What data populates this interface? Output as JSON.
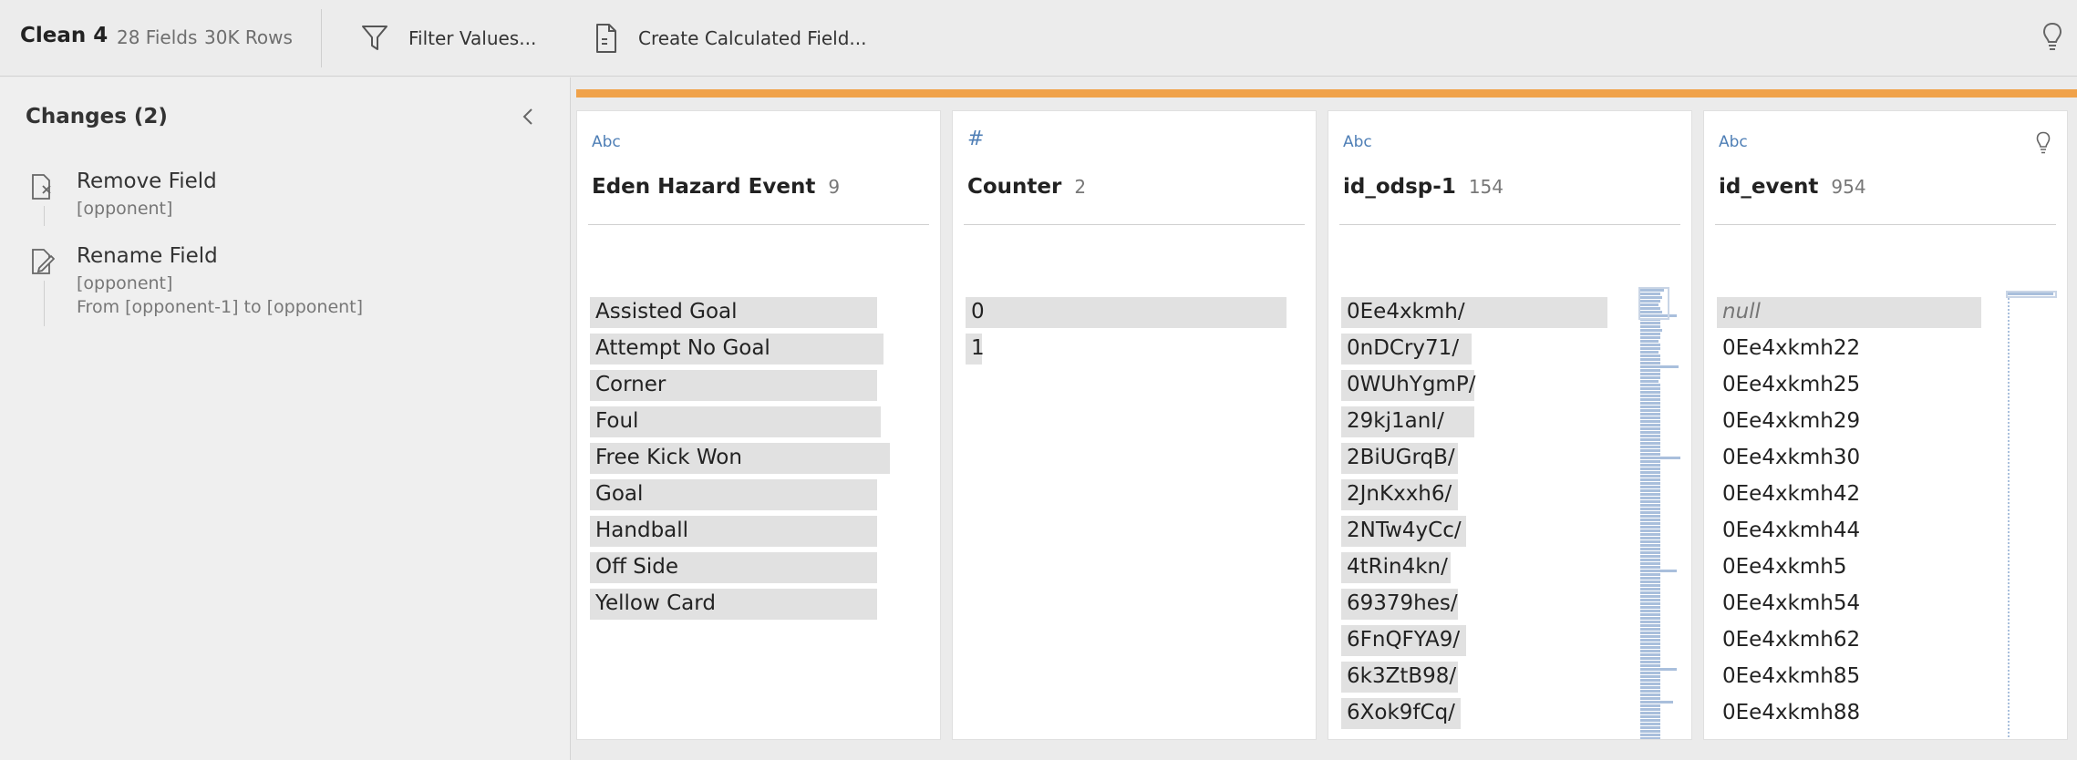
{
  "toolbar": {
    "step_name": "Clean 4",
    "fields": "28 Fields",
    "rows": "30K Rows",
    "filter_label": "Filter Values...",
    "calc_label": "Create Calculated Field..."
  },
  "changes": {
    "title": "Changes (2)",
    "items": [
      {
        "name": "Remove Field",
        "detail1": "[opponent]",
        "detail2": ""
      },
      {
        "name": "Rename Field",
        "detail1": "[opponent]",
        "detail2": "From [opponent-1] to [opponent]"
      }
    ]
  },
  "colors": {
    "accent": "#f0a24a",
    "type_label": "#4f7fb6",
    "bar": "#e1e1e1",
    "histogram": "#a9bfdc"
  },
  "cards": [
    {
      "type": "Abc",
      "name": "Eden Hazard Event",
      "count": "9",
      "values": [
        "Assisted Goal",
        "Attempt No Goal",
        "Corner",
        "Foul",
        "Free Kick Won",
        "Goal",
        "Handball",
        "Off Side",
        "Yellow Card"
      ],
      "fractions": [
        0.9,
        0.92,
        0.9,
        0.91,
        0.94,
        0.9,
        0.9,
        0.9,
        0.9
      ]
    },
    {
      "type": "#",
      "name": "Counter",
      "count": "2",
      "values": [
        "0",
        "1"
      ],
      "fractions": [
        1.0,
        0.05
      ]
    },
    {
      "type": "Abc",
      "name": "id_odsp-1",
      "count": "154",
      "values": [
        "0Ee4xkmh/",
        "0nDCry71/",
        "0WUhYgmP/",
        "29kj1anI/",
        "2BiUGrqB/",
        "2JnKxxh6/",
        "2NTw4yCc/",
        "4tRin4kn/",
        "69379hes/",
        "6FnQFYA9/",
        "6k3ZtB98/",
        "6Xok9fCq/"
      ],
      "fractions": [
        1.0,
        0.49,
        0.5,
        0.5,
        0.44,
        0.44,
        0.47,
        0.41,
        0.44,
        0.47,
        0.44,
        0.45
      ]
    },
    {
      "type": "Abc",
      "name": "id_event",
      "count": "954",
      "values": [
        "null",
        "0Ee4xkmh22",
        "0Ee4xkmh25",
        "0Ee4xkmh29",
        "0Ee4xkmh30",
        "0Ee4xkmh42",
        "0Ee4xkmh44",
        "0Ee4xkmh5",
        "0Ee4xkmh54",
        "0Ee4xkmh62",
        "0Ee4xkmh85",
        "0Ee4xkmh88"
      ],
      "fractions": [
        1.0,
        0,
        0,
        0,
        0,
        0,
        0,
        0,
        0,
        0,
        0,
        0
      ]
    }
  ]
}
